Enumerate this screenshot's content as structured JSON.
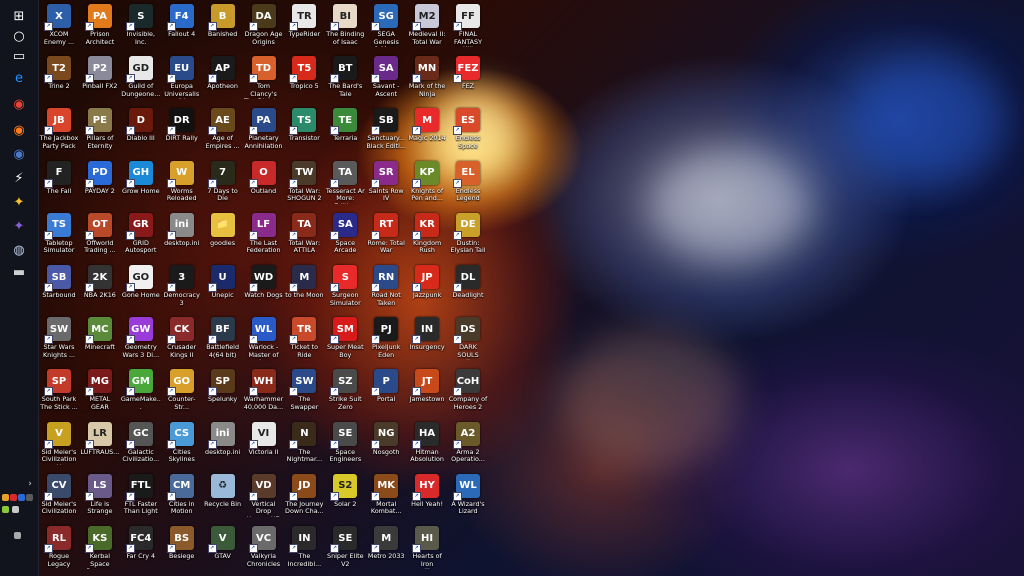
{
  "wallpaper": {
    "description_colors": [
      "#ffb640",
      "#b83a10",
      "#2a4da0",
      "#c8d0e8"
    ]
  },
  "taskbar": {
    "icons": [
      {
        "name": "start-icon",
        "glyph": "⊞",
        "color": "#ffffff"
      },
      {
        "name": "search-icon",
        "glyph": "○",
        "color": "#ffffff"
      },
      {
        "name": "task-view-icon",
        "glyph": "▭",
        "color": "#ffffff"
      },
      {
        "name": "edge-icon",
        "glyph": "e",
        "color": "#1e90ff"
      },
      {
        "name": "chrome-icon",
        "glyph": "◉",
        "color": "#e94335"
      },
      {
        "name": "firefox-icon",
        "glyph": "◉",
        "color": "#ff7a1a"
      },
      {
        "name": "app-icon",
        "glyph": "◉",
        "color": "#4a78c8"
      },
      {
        "name": "flash-icon",
        "glyph": "⚡",
        "color": "#ffffff"
      },
      {
        "name": "app2-icon",
        "glyph": "✦",
        "color": "#f7c22a"
      },
      {
        "name": "app3-icon",
        "glyph": "✦",
        "color": "#8a5cd8"
      },
      {
        "name": "steam-icon",
        "glyph": "◍",
        "color": "#b8c8e0"
      },
      {
        "name": "terminal-icon",
        "glyph": "▬",
        "color": "#cfcfcf"
      }
    ],
    "tray": {
      "chevron": "›"
    }
  },
  "icons": [
    {
      "label": "XCOM\nEnemy ...",
      "abbr": "X",
      "color": "#2d5fa8"
    },
    {
      "label": "Trine 2",
      "abbr": "T2",
      "color": "#7a4a1e"
    },
    {
      "label": "The Jackbox\nParty Pack",
      "abbr": "JB",
      "color": "#d9452b"
    },
    {
      "label": "The Fall",
      "abbr": "F",
      "color": "#222222"
    },
    {
      "label": "Tabletop\nSimulator",
      "abbr": "TS",
      "color": "#3a7bd5"
    },
    {
      "label": "Starbound",
      "abbr": "SB",
      "color": "#4b5aa8"
    },
    {
      "label": "Star Wars\nKnights ...",
      "abbr": "SW",
      "color": "#6a6a6a"
    },
    {
      "label": "South Park\nThe Stick ...",
      "abbr": "SP",
      "color": "#c23a2a"
    },
    {
      "label": "Sid Meier's\nCivilization V",
      "abbr": "V",
      "color": "#c8a020"
    },
    {
      "label": "Sid Meier's\nCivilization ...",
      "abbr": "CV",
      "color": "#3a4a6a"
    },
    {
      "label": "Rogue\nLegacy",
      "abbr": "RL",
      "color": "#8a2a2a"
    },
    {
      "label": "Prison\nArchitect",
      "abbr": "PA",
      "color": "#e07a1a"
    },
    {
      "label": "Pinball FX2",
      "abbr": "P2",
      "color": "#8a8a9a"
    },
    {
      "label": "Pillars of\nEternity",
      "abbr": "PE",
      "color": "#8a7a4a"
    },
    {
      "label": "PAYDAY 2",
      "abbr": "PD",
      "color": "#2a6ad8"
    },
    {
      "label": "Offworld\nTrading ...",
      "abbr": "OT",
      "color": "#b84a2a"
    },
    {
      "label": "NBA 2K16",
      "abbr": "2K",
      "color": "#333333"
    },
    {
      "label": "Minecraft",
      "abbr": "MC",
      "color": "#5a8a3a"
    },
    {
      "label": "METAL GEAR\nSOLID V: T...",
      "abbr": "MG",
      "color": "#7a1a1a"
    },
    {
      "label": "LUFTRAUS...",
      "abbr": "LR",
      "color": "#d8c8a8"
    },
    {
      "label": "Life is Strange",
      "abbr": "LS",
      "color": "#6a5a8a"
    },
    {
      "label": "Kerbal Space\nProgram",
      "abbr": "KS",
      "color": "#4a6a2a"
    },
    {
      "label": "Invisible, Inc.",
      "abbr": "S",
      "color": "#1a2a2a"
    },
    {
      "label": "Guild of\nDungeone...",
      "abbr": "GD",
      "color": "#e8e8e8"
    },
    {
      "label": "Diablo III",
      "abbr": "D",
      "color": "#6a1a0a"
    },
    {
      "label": "Grow Home",
      "abbr": "GH",
      "color": "#1a8ad8"
    },
    {
      "label": "GRID\nAutosport",
      "abbr": "GR",
      "color": "#8a1a1a"
    },
    {
      "label": "Gone Home",
      "abbr": "GO",
      "color": "#f0f0f0"
    },
    {
      "label": "Geometry\nWars 3 Di...",
      "abbr": "GW",
      "color": "#9a3ad8"
    },
    {
      "label": "GameMake...\n1.4",
      "abbr": "GM",
      "color": "#4aa83a"
    },
    {
      "label": "Galactic\nCivilizatio...",
      "abbr": "GC",
      "color": "#555555"
    },
    {
      "label": "FTL Faster\nThan Light",
      "abbr": "FTL",
      "color": "#1a1a1a"
    },
    {
      "label": "Far Cry 4",
      "abbr": "FC4",
      "color": "#2a2a2a"
    },
    {
      "label": "Fallout 4",
      "abbr": "F4",
      "color": "#2a6ac8"
    },
    {
      "label": "Europa\nUniversalis IV",
      "abbr": "EU",
      "color": "#2a4a8a"
    },
    {
      "label": "DiRT Rally",
      "abbr": "DR",
      "color": "#111111"
    },
    {
      "label": "Worms\nReloaded",
      "abbr": "W",
      "color": "#d8a02a"
    },
    {
      "label": "desktop.ini",
      "abbr": "ini",
      "color": "#8a8a8a"
    },
    {
      "label": "Democracy 3",
      "abbr": "3",
      "color": "#1a1a1a"
    },
    {
      "label": "Crusader\nKings II",
      "abbr": "CK",
      "color": "#8a2a2a"
    },
    {
      "label": "Counter-Str...\nGlobal Offe...",
      "abbr": "GO",
      "color": "#d8a02a"
    },
    {
      "label": "Cities\nSkylines",
      "abbr": "CS",
      "color": "#4a9ad8"
    },
    {
      "label": "Cities in\nMotion",
      "abbr": "CM",
      "color": "#4a6a9a"
    },
    {
      "label": "Besiege",
      "abbr": "BS",
      "color": "#8a5a2a"
    },
    {
      "label": "Banished",
      "abbr": "B",
      "color": "#c89a2a"
    },
    {
      "label": "Apotheon",
      "abbr": "AP",
      "color": "#1a1a1a"
    },
    {
      "label": "Age of\nEmpires ...",
      "abbr": "AE",
      "color": "#6a4a1a"
    },
    {
      "label": "7 Days to Die",
      "abbr": "7",
      "color": "#2a2a1a"
    },
    {
      "label": "goodies",
      "abbr": "📁",
      "color": "#e8c040"
    },
    {
      "label": "Unepic",
      "abbr": "U",
      "color": "#1a2a6a"
    },
    {
      "label": "Battlefield\n4(64 bit)",
      "abbr": "BF",
      "color": "#2a3a4a"
    },
    {
      "label": "Spelunky",
      "abbr": "SP",
      "color": "#5a3a1a"
    },
    {
      "label": "desktop.ini",
      "abbr": "ini",
      "color": "#8a8a8a"
    },
    {
      "label": "Recycle Bin",
      "abbr": "♻",
      "color": "#9ab8d8"
    },
    {
      "label": "GTAV",
      "abbr": "V",
      "color": "#3a5a3a"
    },
    {
      "label": "Dragon Age\nOrigins",
      "abbr": "DA",
      "color": "#4a3a1a"
    },
    {
      "label": "Tom Clancy's\nThe Division",
      "abbr": "TD",
      "color": "#d8602a"
    },
    {
      "label": "Planetary\nAnnihilation",
      "abbr": "PA",
      "color": "#2a4a8a"
    },
    {
      "label": "Outland",
      "abbr": "O",
      "color": "#c82a2a"
    },
    {
      "label": "The Last\nFederation",
      "abbr": "LF",
      "color": "#8a2a8a"
    },
    {
      "label": "Watch Dogs",
      "abbr": "WD",
      "color": "#1a1a1a"
    },
    {
      "label": "Warlock -\nMaster of t...",
      "abbr": "WL",
      "color": "#2a5ac8"
    },
    {
      "label": "Warhammer\n40,000 Da...",
      "abbr": "WH",
      "color": "#8a2a1a"
    },
    {
      "label": "Victoria II",
      "abbr": "VI",
      "color": "#e8e8e8"
    },
    {
      "label": "Vertical Drop\nHeroes HD",
      "abbr": "VD",
      "color": "#5a3a2a"
    },
    {
      "label": "Valkyria\nChronicles",
      "abbr": "VC",
      "color": "#6a6a6a"
    },
    {
      "label": "TypeRider",
      "abbr": "TR",
      "color": "#e8e8e8"
    },
    {
      "label": "Tropico 5",
      "abbr": "T5",
      "color": "#d82a1a"
    },
    {
      "label": "Transistor",
      "abbr": "TS",
      "color": "#2a8a6a"
    },
    {
      "label": "Total War:\nSHOGUN 2",
      "abbr": "TW",
      "color": "#4a3a2a"
    },
    {
      "label": "Total War:\nATTILA",
      "abbr": "TA",
      "color": "#8a2a1a"
    },
    {
      "label": "to the Moon",
      "abbr": "M",
      "color": "#2a2a4a"
    },
    {
      "label": "Ticket to Ride",
      "abbr": "TR",
      "color": "#c84a2a"
    },
    {
      "label": "The Swapper",
      "abbr": "SW",
      "color": "#2a4a8a"
    },
    {
      "label": "The\nNightmar...",
      "abbr": "N",
      "color": "#3a2a1a"
    },
    {
      "label": "The Journey\nDown Cha...",
      "abbr": "JD",
      "color": "#8a4a1a"
    },
    {
      "label": "The\nIncredibl...",
      "abbr": "IN",
      "color": "#2a2a2a"
    },
    {
      "label": "The Binding\nof Isaac",
      "abbr": "BI",
      "color": "#e8d8c8"
    },
    {
      "label": "The Bard's\nTale",
      "abbr": "BT",
      "color": "#1a1a1a"
    },
    {
      "label": "Terraria",
      "abbr": "TE",
      "color": "#3a8a3a"
    },
    {
      "label": "Tesseract Ar\nMore: Edition",
      "abbr": "TA",
      "color": "#5a5a5a"
    },
    {
      "label": "Space Arcade",
      "abbr": "SA",
      "color": "#2a2a8a"
    },
    {
      "label": "Surgeon\nSimulator",
      "abbr": "S",
      "color": "#e82a2a"
    },
    {
      "label": "Super Meat\nBoy",
      "abbr": "SM",
      "color": "#d81a1a"
    },
    {
      "label": "Strike Suit\nZero",
      "abbr": "SZ",
      "color": "#4a4a4a"
    },
    {
      "label": "Space\nEngineers",
      "abbr": "SE",
      "color": "#4a4a4a"
    },
    {
      "label": "Solar 2",
      "abbr": "S2",
      "color": "#d8c82a"
    },
    {
      "label": "Sniper Elite\nV2",
      "abbr": "SE",
      "color": "#2a2a2a"
    },
    {
      "label": "SEGA Genesis\n& Mega Dri...",
      "abbr": "SG",
      "color": "#2a6ab8"
    },
    {
      "label": "Savant -\nAscent",
      "abbr": "SA",
      "color": "#6a2a8a"
    },
    {
      "label": "Sanctuary...\nBlack Editi...",
      "abbr": "SB",
      "color": "#1a1a1a"
    },
    {
      "label": "Saints Row IV",
      "abbr": "SR",
      "color": "#8a2a8a"
    },
    {
      "label": "Rome: Total\nWar",
      "abbr": "RT",
      "color": "#c82a1a"
    },
    {
      "label": "Road Not\nTaken",
      "abbr": "RN",
      "color": "#2a4a8a"
    },
    {
      "label": "PixelJunk\nEden",
      "abbr": "PJ",
      "color": "#1a1a1a"
    },
    {
      "label": "Portal",
      "abbr": "P",
      "color": "#2a4a8a"
    },
    {
      "label": "Nosgoth",
      "abbr": "NG",
      "color": "#4a3a2a"
    },
    {
      "label": "Mortal\nKombat...",
      "abbr": "MK",
      "color": "#8a4a1a"
    },
    {
      "label": "Metro 2033",
      "abbr": "M",
      "color": "#3a3a3a"
    },
    {
      "label": "Medieval II:\nTotal War",
      "abbr": "M2",
      "color": "#c8c8d8"
    },
    {
      "label": "Mark of the\nNinja",
      "abbr": "MN",
      "color": "#6a2a1a"
    },
    {
      "label": "Magic 2014",
      "abbr": "M",
      "color": "#e82a2a"
    },
    {
      "label": "Knights of\nPen and...",
      "abbr": "KP",
      "color": "#6a8a2a"
    },
    {
      "label": "Kingdom\nRush",
      "abbr": "KR",
      "color": "#c82a1a"
    },
    {
      "label": "Jazzpunk",
      "abbr": "JP",
      "color": "#d82a1a"
    },
    {
      "label": "Insurgency",
      "abbr": "IN",
      "color": "#2a2a2a"
    },
    {
      "label": "Jamestown",
      "abbr": "JT",
      "color": "#c84a1a"
    },
    {
      "label": "Hitman\nAbsolution",
      "abbr": "HA",
      "color": "#2a2a2a"
    },
    {
      "label": "Hell Yeah!",
      "abbr": "HY",
      "color": "#d82a2a"
    },
    {
      "label": "Hearts of Iron\nIII",
      "abbr": "HI",
      "color": "#5a5a4a"
    },
    {
      "label": "FINAL\nFANTASY XIII",
      "abbr": "FF",
      "color": "#e8e8e8"
    },
    {
      "label": "FEZ",
      "abbr": "FEZ",
      "color": "#e82a2a"
    },
    {
      "label": "Endless Space",
      "abbr": "ES",
      "color": "#d84a2a"
    },
    {
      "label": "Endless\nLegend",
      "abbr": "EL",
      "color": "#d8602a"
    },
    {
      "label": "Dustin:\nElysian Tail",
      "abbr": "DE",
      "color": "#c8a02a"
    },
    {
      "label": "Deadlight",
      "abbr": "DL",
      "color": "#2a2a2a"
    },
    {
      "label": "DARK SOULS\nII",
      "abbr": "DS",
      "color": "#4a3a2a"
    },
    {
      "label": "Company of\nHeroes 2",
      "abbr": "CoH",
      "color": "#3a3a3a"
    },
    {
      "label": "Arma 2\nOperatio...",
      "abbr": "A2",
      "color": "#6a5a2a"
    },
    {
      "label": "A Wizard's\nLizard",
      "abbr": "WL",
      "color": "#2a6ab8"
    }
  ]
}
